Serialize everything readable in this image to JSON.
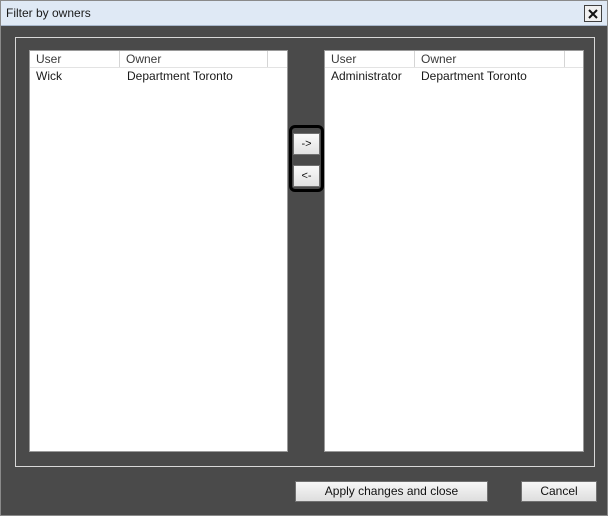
{
  "window": {
    "title": "Filter by owners",
    "close_icon": "close-icon (×)"
  },
  "left_list": {
    "columns": [
      "User",
      "Owner"
    ],
    "rows": [
      {
        "user": "Wick",
        "owner": "Department Toronto"
      }
    ]
  },
  "right_list": {
    "columns": [
      "User",
      "Owner"
    ],
    "rows": [
      {
        "user": "Administrator",
        "owner": "Department Toronto"
      }
    ]
  },
  "transfer": {
    "move_right_label": "->",
    "move_left_label": "<-"
  },
  "footer": {
    "apply_label": "Apply changes and close",
    "cancel_label": "Cancel"
  },
  "colors": {
    "background": "#4a4a4a",
    "titlebar": "#dfe9f5",
    "list_background": "#ffffff"
  }
}
